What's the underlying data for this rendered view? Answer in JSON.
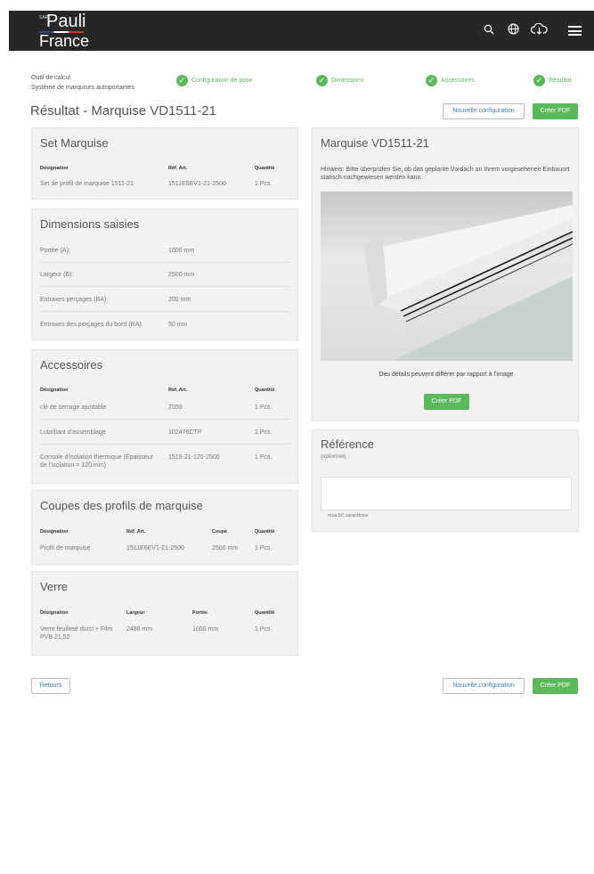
{
  "header": {
    "brand_small": "SARL",
    "brand": "Pauli",
    "brand_sub": "France"
  },
  "steps": {
    "tool_line1": "Outil de calcul",
    "tool_line2": "Système de marquises autoportantes",
    "items": [
      "Configuration de pose",
      "Dimensions",
      "Accessoires",
      "Résultat"
    ]
  },
  "page": {
    "title": "Résultat - Marquise VD1511-21",
    "new_config": "Nouvelle configuration",
    "create_pdf": "Créer PDF",
    "back": "Retours"
  },
  "set": {
    "title": "Set Marquise",
    "h1": "Désignation",
    "h2": "Réf. Art.",
    "h3": "Quantité",
    "row": [
      "Set de profil de marquise 1511-21",
      "1511E6EV1-21-2500",
      "1 Pcs."
    ]
  },
  "dims": {
    "title": "Dimensions saisies",
    "rows": [
      [
        "Portée (A):",
        "1000 mm"
      ],
      [
        "Largeur (B):",
        "2500 mm"
      ],
      [
        "Entraxes perçages (BA):",
        "200 mm"
      ],
      [
        "Entraxes des perçages du bord (RA):",
        "50 mm"
      ]
    ]
  },
  "acc": {
    "title": "Accessoires",
    "h1": "Désignation",
    "h2": "Réf. Art.",
    "h3": "Quantité",
    "rows": [
      [
        "clé de serrage ajustable",
        "Z059",
        "1 Pcs."
      ],
      [
        "Lubrifiant d'assemblage",
        "102476CTP",
        "1 Pcs."
      ],
      [
        "Console d'isolation thermique (Épaisseur de l'isolation = 120 mm)",
        "1519-21-120-2500",
        "1 Pcs."
      ]
    ]
  },
  "cuts": {
    "title": "Coupes des profils de marquise",
    "h1": "Désignation",
    "h2": "Réf. Art.",
    "h3": "Coupe",
    "h4": "Quantité",
    "row": [
      "Profil de marquise",
      "1511E6EV1-21-2500",
      "2500 mm",
      "1 Pcs."
    ]
  },
  "glass": {
    "title": "Verre",
    "h1": "Désignation",
    "h2": "Largeur",
    "h3": "Portée",
    "h4": "Quantité",
    "row": [
      "Verre feuilleté durci + Film PVB 21,52",
      "2498 mm",
      "1000 mm",
      "1 Pcs."
    ]
  },
  "product": {
    "title": "Marquise VD1511-21",
    "note": "Hinweis: Bitte überprüfen Sie, ob das geplante Vordach an Ihrem vorgesehenen Einbauort statisch nachgewiesen werden kann.",
    "caption": "Des détails peuvent différer par rapport à l'image",
    "pdf": "Créer PDF"
  },
  "reference": {
    "title": "Référence",
    "optional": "(optionnel)",
    "value": "",
    "hint": "max 50 caractères"
  },
  "colors": {
    "accent": "#5cb85c",
    "link": "#3c7bbf",
    "header": "#272727"
  }
}
